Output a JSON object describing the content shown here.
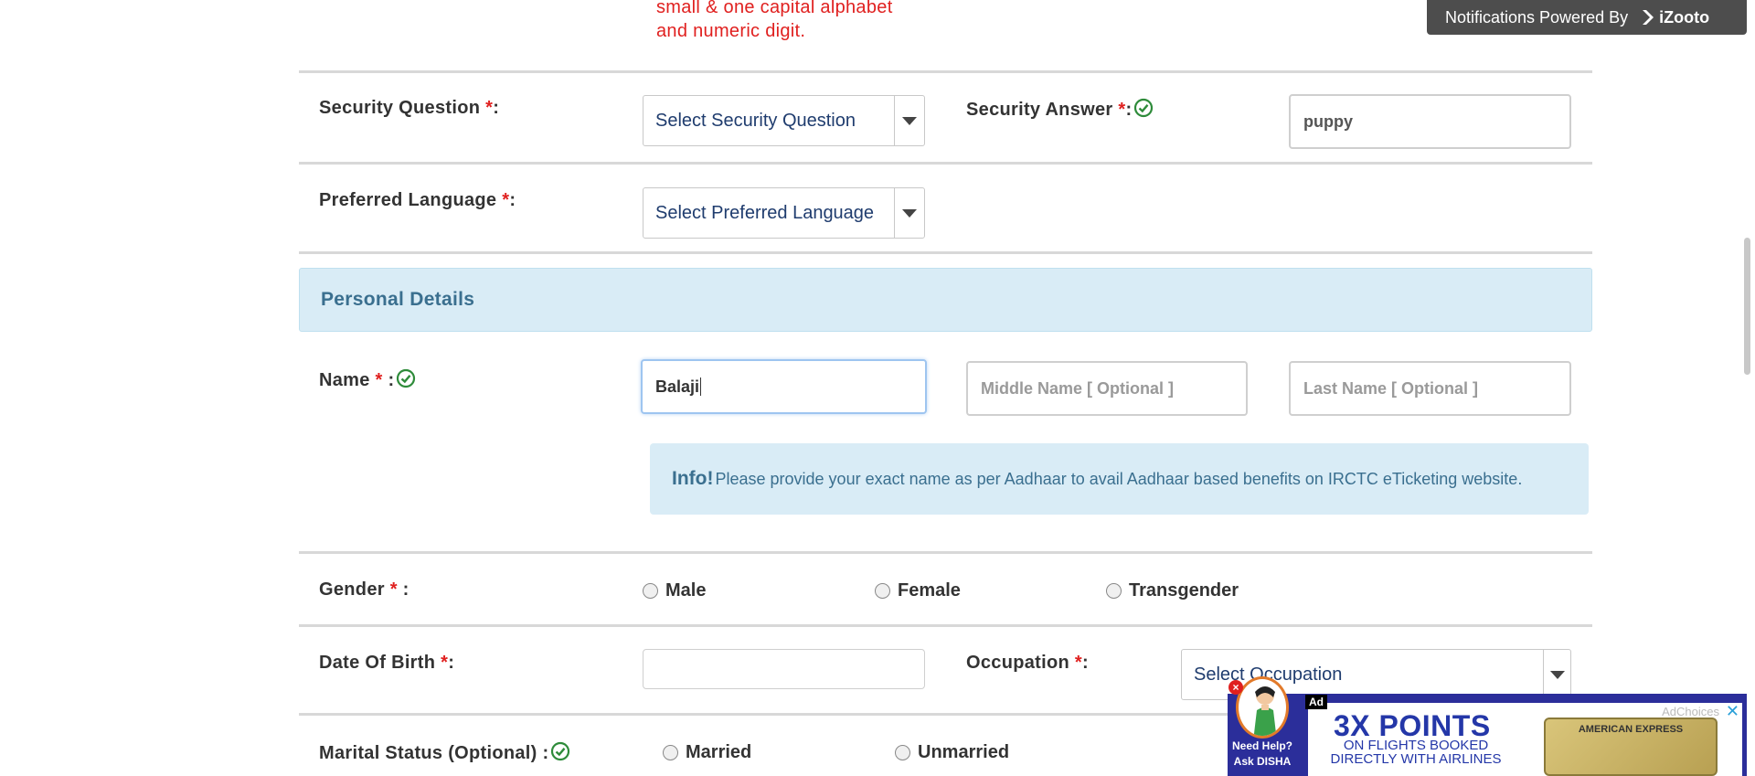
{
  "password_hint": {
    "line1": "small & one capital alphabet",
    "line2": "and numeric digit."
  },
  "notification_bar": {
    "text": "Notifications Powered By",
    "brand": "iZooto"
  },
  "security": {
    "question_label": "Security Question",
    "question_selected": "Select Security Question",
    "answer_label": "Security Answer",
    "answer_value": "puppy"
  },
  "language": {
    "label": "Preferred Language",
    "selected": "Select Preferred Language"
  },
  "personal": {
    "title": "Personal Details",
    "name_label": "Name",
    "first_name_value": "Balaji",
    "middle_name_placeholder": "Middle Name  [ Optional ]",
    "last_name_placeholder": "Last Name  [ Optional ]",
    "info_strong": "Info!",
    "info_text": "Please provide your exact name as per Aadhaar to avail Aadhaar based benefits on IRCTC eTicketing website."
  },
  "gender": {
    "label": "Gender",
    "options": [
      "Male",
      "Female",
      "Transgender"
    ]
  },
  "dob": {
    "label": "Date Of Birth",
    "value": ""
  },
  "occupation": {
    "label": "Occupation",
    "selected": "Select Occupation"
  },
  "marital": {
    "label": "Marital Status (Optional)",
    "options": [
      "Married",
      "Unmarried"
    ]
  },
  "required_marker": "*",
  "ad": {
    "badge": "Ad",
    "headline": "3X POINTS",
    "line1": "ON FLIGHTS BOOKED",
    "line2": "DIRECTLY WITH AIRLINES",
    "choices": "AdChoices",
    "card_text": "AMERICAN EXPRESS",
    "disha_line1": "Need Help?",
    "disha_line2": "Ask DISHA"
  },
  "colors": {
    "required": "#e0201f",
    "select_text": "#1f3c6e",
    "section_bg": "#d9ecf6",
    "section_text": "#3a6f8f",
    "check_green": "#2e8b3a"
  }
}
